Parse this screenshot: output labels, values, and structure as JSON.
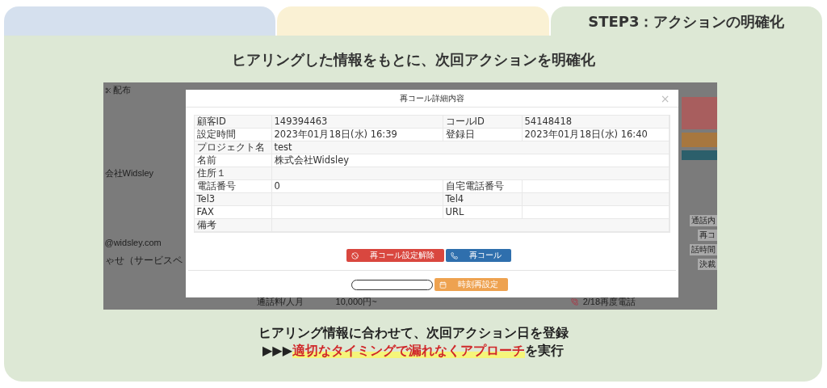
{
  "tabs": [
    {
      "selected": false,
      "color": "#d5e0ee"
    },
    {
      "selected": false,
      "color": "#faf1d4"
    },
    {
      "label": "STEP3：アクションの明確化",
      "selected": true,
      "color": "#dde8d5"
    }
  ],
  "heading": "ヒアリングした情報をもとに、次回アクションを明確化",
  "screenshot": {
    "background": {
      "menu_item": "配布",
      "company": "会社Widsley",
      "email": "@widsley.com",
      "inquiry": "ゃせ（サービスペ",
      "fee_label": "通話料/人月",
      "fee_value": "10,000円~",
      "call_note": "2/18再度電話",
      "call_content": "通話内",
      "recall": "再コ",
      "call_time": "話時間",
      "payment": "決裁"
    },
    "modal": {
      "title": "再コール詳細内容",
      "close": "×",
      "rows": [
        {
          "kind": "pair",
          "label": "顧客ID",
          "value": "149394463",
          "label2": "コールID",
          "value2": "54148418"
        },
        {
          "kind": "pair",
          "label": "設定時間",
          "value": "2023年01月18日(水) 16:39",
          "label2": "登録日",
          "value2": "2023年01月18日(水) 16:40"
        },
        {
          "kind": "wide",
          "label": "プロジェクト名",
          "value": "test"
        },
        {
          "kind": "wide",
          "label": "名前",
          "value": "株式会社Widsley"
        },
        {
          "kind": "wide",
          "label": "住所１"
        },
        {
          "kind": "pair",
          "label": "電話番号",
          "value": "0",
          "label2": "自宅電話番号"
        },
        {
          "kind": "pair",
          "label": "Tel3",
          "label2": "Tel4"
        },
        {
          "kind": "pair",
          "label": "FAX",
          "label2": "URL"
        },
        {
          "kind": "wide",
          "label": "備考"
        }
      ],
      "buttons": [
        {
          "kind": "cancel",
          "label": "再コール設定解除"
        },
        {
          "kind": "call",
          "label": "再コール"
        }
      ],
      "reset_button": "時刻再設定"
    }
  },
  "caption": {
    "line1": "ヒアリング情報に合わせて、次回アクション日を登録",
    "prefix": "▶▶▶",
    "highlight": "適切なタイミングで漏れなくアプローチ",
    "suffix": "を実行"
  }
}
